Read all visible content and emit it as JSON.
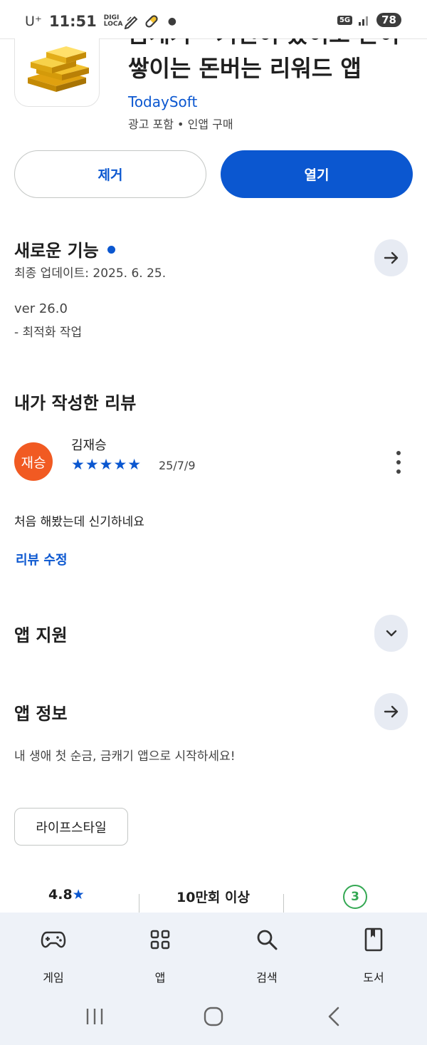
{
  "status_bar": {
    "carrier": "U⁺",
    "time": "11:51",
    "digi_label": "DIGI LOCA",
    "network": "5G",
    "battery": "78"
  },
  "app": {
    "title_line1": "금캐기 - 커린이 쏬이로 돈이",
    "title_line2": "쌓이는 돈버는 리워드 앱",
    "developer": "TodaySoft",
    "meta": "광고 포함 • 인앱 구매"
  },
  "actions": {
    "remove_label": "제거",
    "open_label": "열기"
  },
  "whats_new": {
    "title": "새로운 기능",
    "last_updated": "최종 업데이트: 2025. 6. 25.",
    "version": "ver 26.0",
    "notes": "- 최적화 작업"
  },
  "my_review": {
    "title": "내가 작성한 리뷰",
    "avatar_text": "재승",
    "reviewer_name": "김재승",
    "stars": "★★★★★",
    "rating": 5,
    "date": "25/7/9",
    "text": "처음 해봤는데 신기하네요",
    "edit_label": "리뷰 수정"
  },
  "app_support": {
    "title": "앱 지원"
  },
  "app_info": {
    "title": "앱 정보",
    "description": "내 생애 첫 순금, 금캐기 앱으로 시작하세요!",
    "category_chip": "라이프스타일"
  },
  "stats": {
    "rating": "4.8",
    "rating_star": "★",
    "downloads": "10만회 이상",
    "age_rating": "3"
  },
  "bottom_nav": {
    "items": [
      {
        "label": "게임",
        "icon": "gamepad-icon"
      },
      {
        "label": "앱",
        "icon": "apps-grid-icon"
      },
      {
        "label": "검색",
        "icon": "search-icon"
      },
      {
        "label": "도서",
        "icon": "book-icon"
      }
    ]
  },
  "colors": {
    "accent": "#0b57d0",
    "avatar": "#f15a22",
    "age_badge": "#34a853",
    "nav_bg": "#eef2f8"
  }
}
